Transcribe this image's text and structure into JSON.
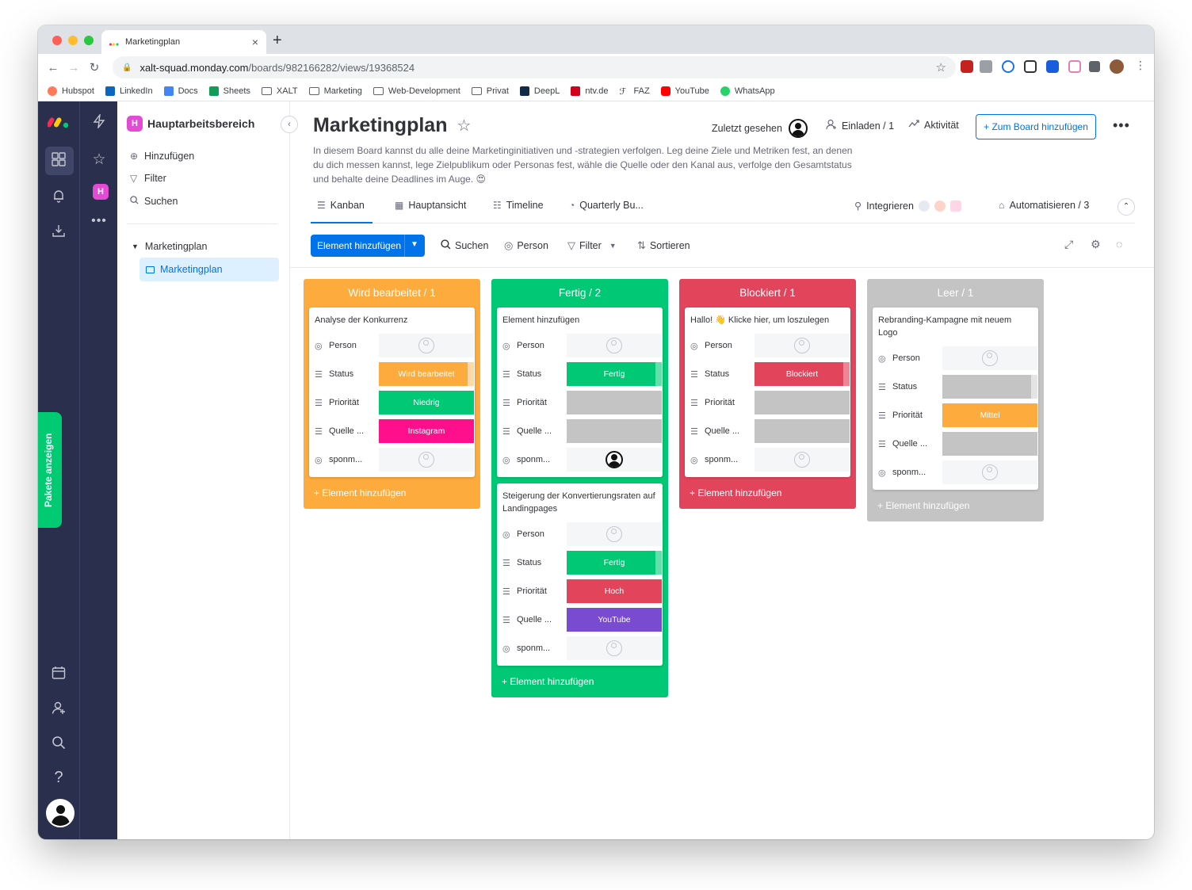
{
  "browser": {
    "tab_title": "Marketingplan",
    "url_host": "xalt-squad.monday.com",
    "url_path": "/boards/982166282/views/19368524",
    "bookmarks": [
      "Hubspot",
      "LinkedIn",
      "Docs",
      "Sheets",
      "XALT",
      "Marketing",
      "Web-Development",
      "Privat",
      "DeepL",
      "ntv.de",
      "FAZ",
      "YouTube",
      "WhatsApp"
    ]
  },
  "rail": {
    "pakete_label": "Pakete anzeigen",
    "ws_letter": "H"
  },
  "workspace": {
    "title": "Hauptarbeitsbereich",
    "letter": "H",
    "add": "Hinzufügen",
    "filter": "Filter",
    "search": "Suchen",
    "folder": "Marketingplan",
    "board": "Marketingplan"
  },
  "board": {
    "title": "Marketingplan",
    "description": "In diesem Board kannst du alle deine Marketinginitiativen und -strategien verfolgen. Leg deine Ziele und Metriken fest, an denen du dich messen kannst, lege Zielpublikum oder Personas fest, wähle die Quelle oder den Kanal aus, verfolge den Gesamtstatus und behalte deine Deadlines im Auge. 😍",
    "last_seen": "Zuletzt gesehen",
    "invite": "Einladen / 1",
    "activity": "Aktivität",
    "add_to_board": "+ Zum Board hinzufügen"
  },
  "views": {
    "kanban": "Kanban",
    "main": "Hauptansicht",
    "timeline": "Timeline",
    "quarterly": "Quarterly Bu...",
    "integrate": "Integrieren",
    "automate": "Automatisieren / 3"
  },
  "actions": {
    "add_item": "Element hinzufügen",
    "search": "Suchen",
    "person": "Person",
    "filter": "Filter",
    "sort": "Sortieren"
  },
  "labels": {
    "person": "Person",
    "status": "Status",
    "priority": "Priorität",
    "source": "Quelle ...",
    "sponm": "sponm...",
    "add_footer": "+ Element hinzufügen"
  },
  "columns": [
    {
      "title": "Wird bearbeitet / 1",
      "color": "#fdab3d",
      "cards": [
        {
          "title": "Analyse der Konkurrenz",
          "status": "Wird bearbeitet",
          "priority": "Niedrig",
          "source": "Instagram"
        }
      ]
    },
    {
      "title": "Fertig / 2",
      "color": "#00c875",
      "cards": [
        {
          "title": "Element hinzufügen",
          "status": "Fertig",
          "priority": "",
          "source": ""
        },
        {
          "title": "Steigerung der Konvertierungsraten auf Landingpages",
          "status": "Fertig",
          "priority": "Hoch",
          "source": "YouTube"
        }
      ]
    },
    {
      "title": "Blockiert / 1",
      "color": "#e2445c",
      "cards": [
        {
          "title": "Hallo! 👋 Klicke hier, um loszulegen",
          "status": "Blockiert",
          "priority": "",
          "source": ""
        }
      ]
    },
    {
      "title": "Leer / 1",
      "color": "#c4c4c4",
      "cards": [
        {
          "title": "Rebranding-Kampagne mit neuem Logo",
          "status": "",
          "priority": "Mittel",
          "source": ""
        }
      ]
    }
  ],
  "colors": {
    "primary": "#0073ea",
    "working": "#fdab3d",
    "done": "#00c875",
    "stuck": "#e2445c",
    "empty": "#c4c4c4",
    "low": "#00c875",
    "high": "#e2445c",
    "medium": "#fdab3d",
    "instagram": "#ff0f8b",
    "youtube": "#784bd1",
    "rail": "#292f4c"
  }
}
